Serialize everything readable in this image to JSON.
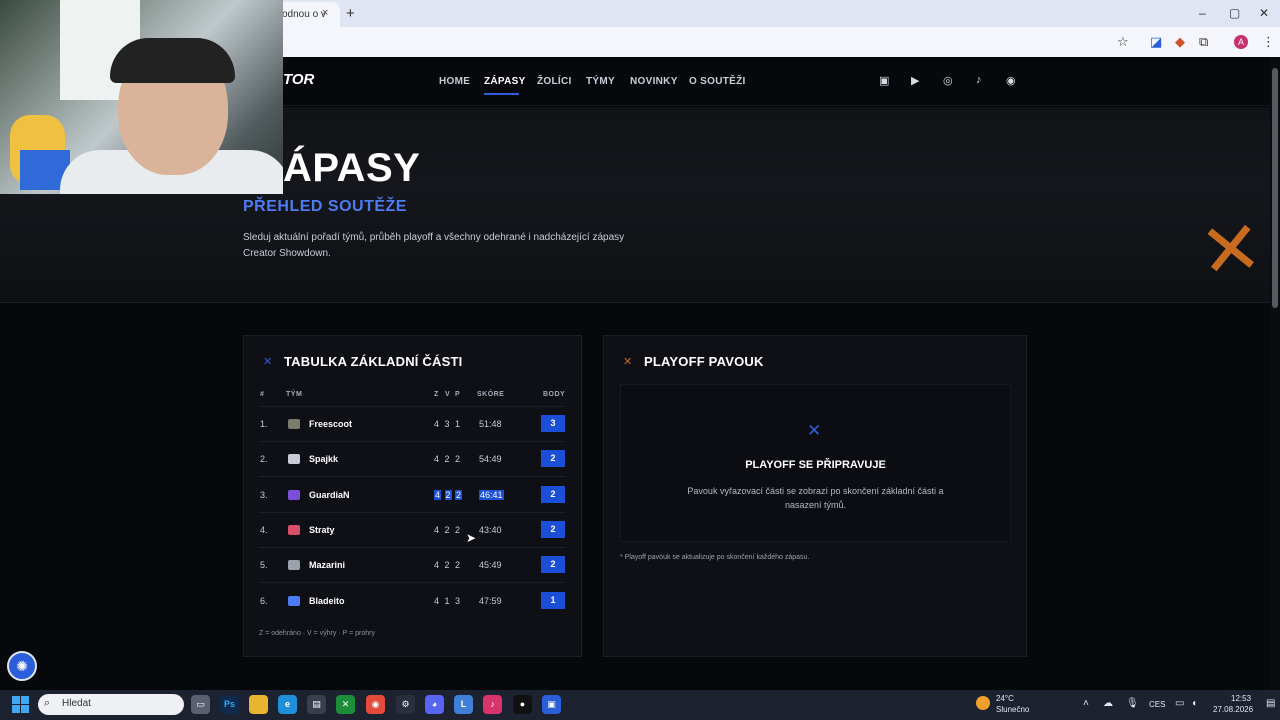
{
  "browser": {
    "tab_title": "odnou o v",
    "tab_close": "×",
    "new_tab": "+",
    "window_controls": [
      "–",
      "▢",
      "✕"
    ],
    "toolbar_icons": [
      "star-icon",
      "pen-icon",
      "fox-extension-icon",
      "puzzle-icon"
    ],
    "profile_initial": "A",
    "menu": "⋮"
  },
  "site": {
    "logo": "TOR",
    "nav": [
      "HOME",
      "ZÁPASY",
      "ŽOLÍCI",
      "TÝMY",
      "NOVINKY",
      "O SOUTĚŽI"
    ],
    "active_nav": "ZÁPASY",
    "social_icons": [
      "twitch-icon",
      "youtube-icon",
      "instagram-icon",
      "tiktok-icon",
      "discord-icon"
    ]
  },
  "hero": {
    "title": "ÁPASY",
    "subtitle": "PŘEHLED SOUTĚŽE",
    "description": "Sleduj aktuální pořadí týmů, průběh playoff a všechny odehrané i nadcházející zápasy Creator Showdown."
  },
  "standings": {
    "title": "TABULKA ZÁKLADNÍ ČÁSTI",
    "headers": {
      "rank": "#",
      "team": "TÝM",
      "z": "Z",
      "v": "V",
      "p": "P",
      "score": "SKÓRE",
      "points": "BODY"
    },
    "rows": [
      {
        "rank": "1.",
        "team": "Freescoot",
        "z": "4",
        "v": "3",
        "p": "1",
        "score": "51:48",
        "points": "3",
        "icon_color": "#7a7d6a"
      },
      {
        "rank": "2.",
        "team": "Spajkk",
        "z": "4",
        "v": "2",
        "p": "2",
        "score": "54:49",
        "points": "2",
        "icon_color": "#c8ccd6"
      },
      {
        "rank": "3.",
        "team": "GuardiaN",
        "z": "4",
        "v": "2",
        "p": "2",
        "score": "46:41",
        "points": "2",
        "icon_color": "#7b4fd8"
      },
      {
        "rank": "4.",
        "team": "Straty",
        "z": "4",
        "v": "2",
        "p": "2",
        "score": "43:40",
        "points": "2",
        "icon_color": "#d84f6a"
      },
      {
        "rank": "5.",
        "team": "Mazarini",
        "z": "4",
        "v": "2",
        "p": "2",
        "score": "45:49",
        "points": "2",
        "icon_color": "#9ca1ae"
      },
      {
        "rank": "6.",
        "team": "Bladeito",
        "z": "4",
        "v": "1",
        "p": "3",
        "score": "47:59",
        "points": "1",
        "icon_color": "#4d7bf3"
      }
    ],
    "legend": "Z = odehráno · V = výhry · P = prohry"
  },
  "playoff": {
    "title": "PLAYOFF PAVOUK",
    "status_title": "PLAYOFF SE PŘIPRAVUJE",
    "status_desc": "Pavouk vyřazovací části se zobrazí po skončení základní části a nasazení týmů.",
    "footnote": "* Playoff pavouk se aktualizuje po skončení každého zápasu."
  },
  "taskbar": {
    "search_placeholder": "Hledat",
    "apps": [
      "file-explorer-icon",
      "photoshop-icon",
      "folder-icon",
      "edge-icon",
      "store-icon",
      "xbox-icon",
      "chrome-icon",
      "steam-icon",
      "discord-icon",
      "editor-icon",
      "tiktok-icon",
      "obs-icon",
      "app-icon"
    ],
    "weather_temp": "24°C",
    "weather_desc": "Slunečno",
    "language": "CES",
    "time": "12:53",
    "date": "27.08.2026"
  },
  "colors": {
    "accent": "#2c5ddb",
    "subtitle": "#4d7bf3",
    "orange": "#c76b1e",
    "background": "#07080c"
  }
}
